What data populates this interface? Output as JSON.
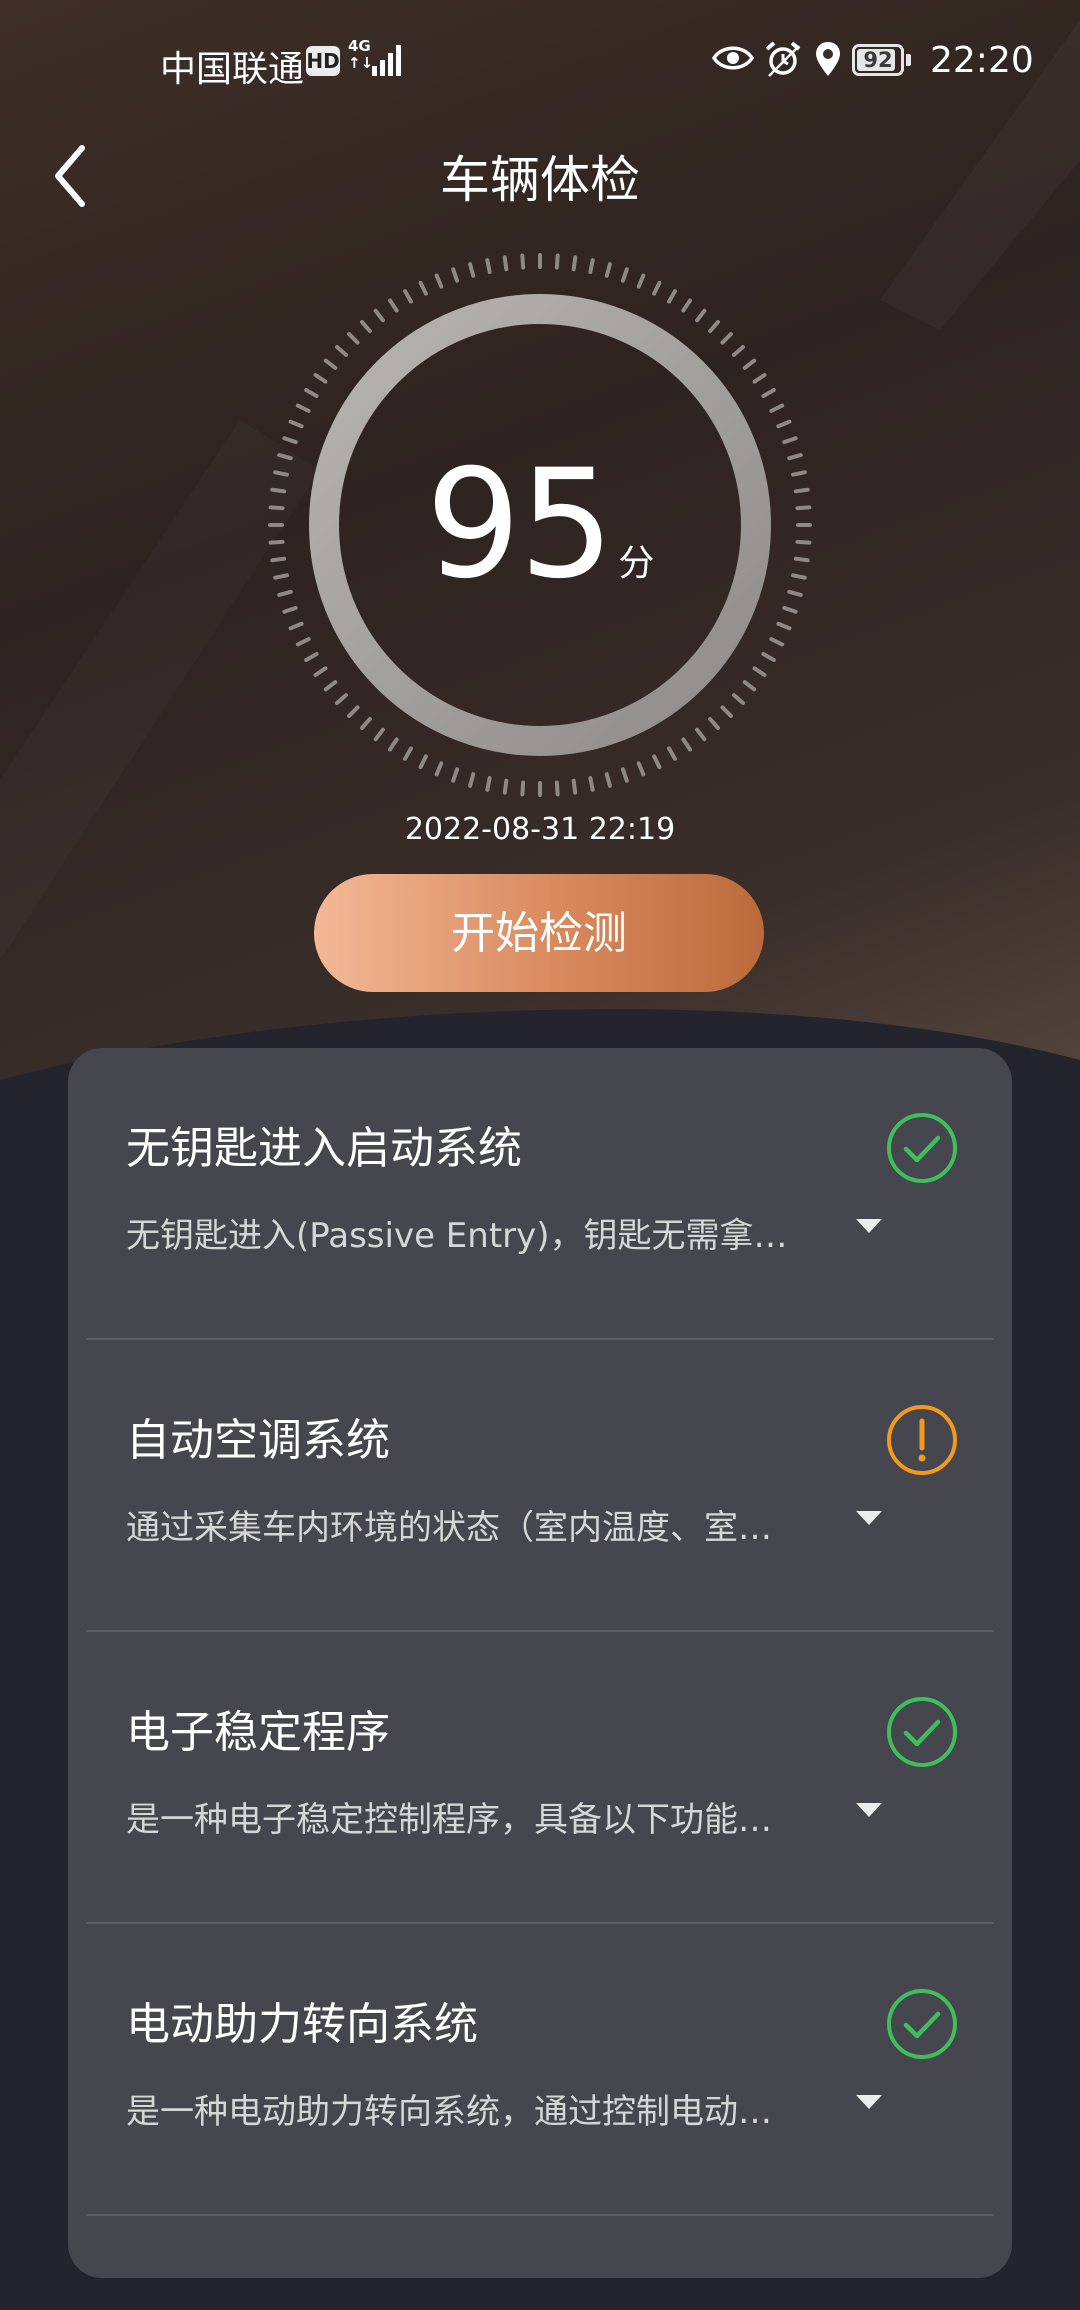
{
  "status_bar": {
    "carrier": "中国联通",
    "hd": "HD",
    "network_top": "4G",
    "network_bottom": "↑↓",
    "battery": "92",
    "battery_level": 0.92,
    "time": "22:20"
  },
  "header": {
    "title": "车辆体检",
    "back_icon": "chevron-left-icon"
  },
  "score": {
    "value": "95",
    "unit": "分"
  },
  "check_time": "2022-08-31 22:19",
  "start_button": "开始检测",
  "items": [
    {
      "title": "无钥匙进入启动系统",
      "desc": "无钥匙进入(Passive Entry)，钥匙无需拿…",
      "status": "ok",
      "status_icon": "check-circle-icon"
    },
    {
      "title": "自动空调系统",
      "desc": "通过采集车内环境的状态（室内温度、室…",
      "status": "warning",
      "status_icon": "warning-circle-icon"
    },
    {
      "title": "电子稳定程序",
      "desc": "是一种电子稳定控制程序，具备以下功能…",
      "status": "ok",
      "status_icon": "check-circle-icon"
    },
    {
      "title": "电动助力转向系统",
      "desc": "是一种电动助力转向系统，通过控制电动…",
      "status": "ok",
      "status_icon": "check-circle-icon"
    }
  ],
  "colors": {
    "ok": "#3fbf5c",
    "warning": "#f39a1e",
    "accent_start": "#f3b896",
    "accent_end": "#bb6a3b",
    "card": "#46464f",
    "background": "#24242e"
  }
}
